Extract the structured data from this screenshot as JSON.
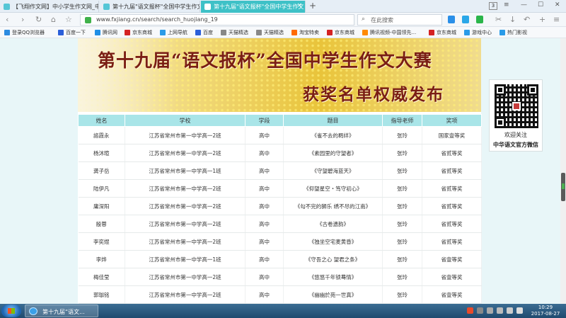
{
  "browser": {
    "tabs": [
      {
        "title": "【飞翔作文网】中小学生作文网_中期"
      },
      {
        "title": "第十九届\"语文报杯\"全国中学生作文"
      },
      {
        "title": "第十九届\"语文报杯\"全国中学生作文"
      }
    ],
    "tab_count": "3",
    "url": "www.fxjiang.cn/search/search_huojiang_19",
    "search_placeholder": "在此搜索"
  },
  "bookmarks": [
    {
      "label": "登录QQ浏览器",
      "color": "#2c8be0"
    },
    {
      "label": "百度一下",
      "color": "#2b5fd9"
    },
    {
      "label": "腾讯网",
      "color": "#1f8ee6"
    },
    {
      "label": "京东商城",
      "color": "#d42323"
    },
    {
      "label": "上网导航",
      "color": "#2a9be8"
    },
    {
      "label": "百度",
      "color": "#2b5fd9"
    },
    {
      "label": "天猫精选",
      "color": "#888888"
    },
    {
      "label": "天猫精选",
      "color": "#888888"
    },
    {
      "label": "淘宝特卖",
      "color": "#ff6a00"
    },
    {
      "label": "京东商城",
      "color": "#d42323"
    },
    {
      "label": "腾讯视频-中国领先...",
      "color": "#ff8a00"
    },
    {
      "label": "京东商城",
      "color": "#d42323"
    },
    {
      "label": "游戏中心",
      "color": "#2a9be8"
    },
    {
      "label": "热门影视",
      "color": "#2a9be8"
    }
  ],
  "banner": {
    "title": "第十九届“语文报杯”全国中学生作文大赛",
    "subtitle": "获奖名单权威发布"
  },
  "table": {
    "headers": [
      "姓名",
      "学校",
      "学段",
      "题目",
      "指导老师",
      "奖项"
    ],
    "rows": [
      [
        "諮霞永",
        "江苏省常州市第一中学高一2班",
        "高中",
        "《雀不去的羁绊》",
        "张玲",
        "国家壹等奖"
      ],
      [
        "杨沐暄",
        "江苏省常州市第一中学高一2班",
        "高中",
        "《素园里的守望者》",
        "张玲",
        "省贰等奖"
      ],
      [
        "龚子岳",
        "江苏省常州市第一中学高一1班",
        "高中",
        "《守望碧海蓝天》",
        "张玲",
        "省贰等奖"
      ],
      [
        "陆伊凡",
        "江苏省常州市第一中学高一2班",
        "高中",
        "《仰望星空・笃守初心》",
        "张玲",
        "省贰等奖"
      ],
      [
        "庸深阳",
        "江苏省常州市第一中学高一2班",
        "高中",
        "《勾不完的狮乐 绣不尽的江南》",
        "张玲",
        "省贰等奖"
      ],
      [
        "殷蓉",
        "江苏省常州市第一中学高一2班",
        "高中",
        "《古卷遗韵》",
        "张玲",
        "省贰等奖"
      ],
      [
        "李奕煜",
        "江苏省常州市第一中学高一2班",
        "高中",
        "《独坐空宅麦黄昏》",
        "张玲",
        "省贰等奖"
      ],
      [
        "李烨",
        "江苏省常州市第一中学高一1班",
        "高中",
        "《守吾之心 望君之条》",
        "张玲",
        "省壹等奖"
      ],
      [
        "梅佳莹",
        "江苏省常州市第一中学高一2班",
        "高中",
        "《悠悠千年锁蓦情》",
        "张玲",
        "省壹等奖"
      ],
      [
        "郭珈铭",
        "江苏省常州市第一中学高一2班",
        "高中",
        "《幽幽於苑一世真》",
        "张玲",
        "省壹等奖"
      ]
    ]
  },
  "qr_panel": {
    "line1": "欢迎关注",
    "line2": "中华语文官方微信"
  },
  "taskbar": {
    "window_title": "第十九届“语文...",
    "time": "10:29",
    "date": "2017-08-27"
  },
  "colors": {
    "tab_active": "#3ec1c7",
    "table_header": "#a9e5e8",
    "banner_text": "#7a1e14"
  }
}
